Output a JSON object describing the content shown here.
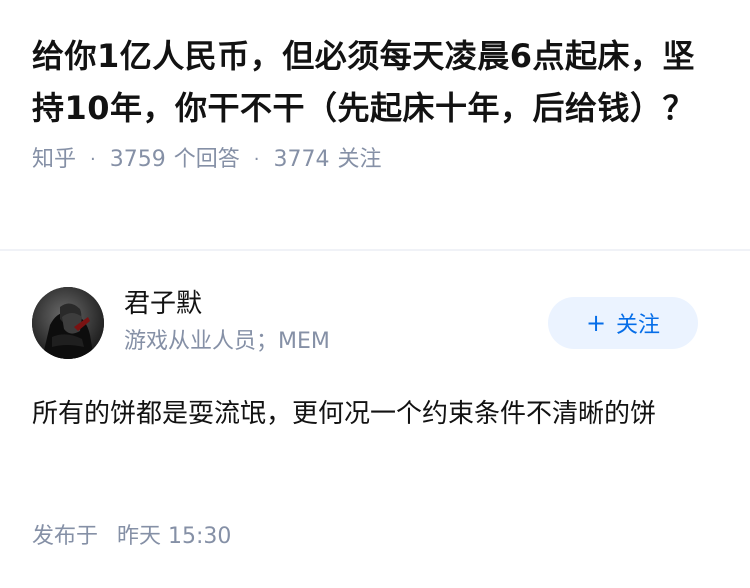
{
  "question": {
    "title": "给你1亿人民币，但必须每天凌晨6点起床，坚持10年，你干不干（先起床十年，后给钱）？",
    "source": "知乎",
    "answer_count": "3759",
    "answer_label": "个回答",
    "follow_count": "3774",
    "follow_label": "关注",
    "separator": "·"
  },
  "author": {
    "name": "君子默",
    "bio": "游戏从业人员；MEM",
    "avatar_icon": "avatar-photo",
    "follow_button": {
      "plus": "+",
      "label": "关注"
    }
  },
  "answer": {
    "content": "所有的饼都是耍流氓，更何况一个约束条件不清晰的饼",
    "published_label": "发布于",
    "published_time": "昨天 15:30"
  },
  "colors": {
    "text_primary": "#121212",
    "text_secondary": "#8590a6",
    "accent": "#056de8",
    "follow_bg": "#ebf3ff",
    "divider": "#f0f2f7"
  }
}
